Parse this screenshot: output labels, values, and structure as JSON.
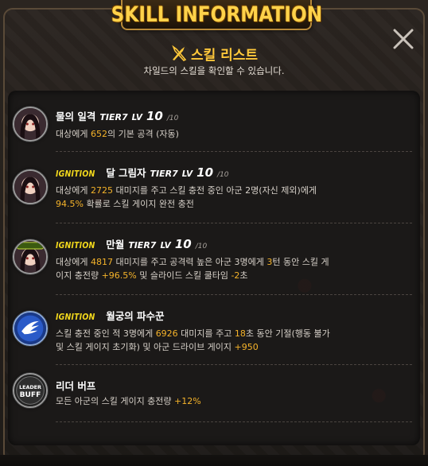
{
  "banner": {
    "title": "SKILL INFORMATION"
  },
  "heading": {
    "title": "스킬 리스트",
    "subtitle": "차일드의 스킬을 확인할 수 있습니다."
  },
  "skills": [
    {
      "ignition": "",
      "name": "물의 일격",
      "tier": "TIER7",
      "lv_label": "LV",
      "lv": "10",
      "lv_max": "/10",
      "desc": [
        {
          "t": "대상에게 ",
          "h": false
        },
        {
          "t": "652",
          "h": true
        },
        {
          "t": "의 기본 공격 (자동)",
          "h": false
        }
      ],
      "avatar_icon": "child-portrait-icon"
    },
    {
      "ignition": "IGNITION",
      "name": "달 그림자",
      "tier": "TIER7",
      "lv_label": "LV",
      "lv": "10",
      "lv_max": "/10",
      "desc": [
        {
          "t": "대상에게 ",
          "h": false
        },
        {
          "t": "2725",
          "h": true
        },
        {
          "t": " 대미지를 주고 스킬 충전 중인 아군 2명(자신 제외)에게 ",
          "h": false
        },
        {
          "t": "94.5%",
          "h": true
        },
        {
          "t": " 확률로 스킬 게이지 완전 충전",
          "h": false
        }
      ],
      "avatar_icon": "child-portrait-icon"
    },
    {
      "ignition": "IGNITION",
      "name": "만월",
      "tier": "TIER7",
      "lv_label": "LV",
      "lv": "10",
      "lv_max": "/10",
      "badge": "DRIVE SKILL",
      "desc": [
        {
          "t": "대상에게 ",
          "h": false
        },
        {
          "t": "4817",
          "h": true
        },
        {
          "t": " 대미지를 주고 공격력 높은 아군 3명에게 ",
          "h": false
        },
        {
          "t": "3",
          "h": true
        },
        {
          "t": "턴 동안 스킬 게이지 충전량 ",
          "h": false
        },
        {
          "t": "+96.5%",
          "h": true
        },
        {
          "t": " 및 슬라이드 스킬 쿨타임 ",
          "h": false
        },
        {
          "t": "-2",
          "h": true
        },
        {
          "t": "초",
          "h": false
        }
      ],
      "avatar_icon": "child-portrait-drive-icon"
    },
    {
      "ignition": "IGNITION",
      "name": "월궁의 파수꾼",
      "tier": "",
      "lv_label": "",
      "lv": "",
      "lv_max": "",
      "desc": [
        {
          "t": "스킬 충전 중인 적 3명에게 ",
          "h": false
        },
        {
          "t": "6926",
          "h": true
        },
        {
          "t": " 대미지를 주고 ",
          "h": false
        },
        {
          "t": "18",
          "h": true
        },
        {
          "t": "초 동안 기절(행동 불가 및 스킬 게이지 초기화) 및 아군 드라이브 게이지 ",
          "h": false
        },
        {
          "t": "+950",
          "h": true
        }
      ],
      "avatar_icon": "wing-emblem-icon"
    },
    {
      "ignition": "",
      "name": "리더 버프",
      "tier": "",
      "lv_label": "",
      "lv": "",
      "lv_max": "",
      "badge": "LEADER BUFF",
      "desc": [
        {
          "t": "모든 아군의 스킬 게이지 충전량 ",
          "h": false
        },
        {
          "t": "+12%",
          "h": true
        }
      ],
      "avatar_icon": "leader-buff-icon"
    }
  ],
  "colors": {
    "accent": "#f5b32a",
    "ignition": "#f2d81c",
    "banner": "#ffd24a"
  }
}
